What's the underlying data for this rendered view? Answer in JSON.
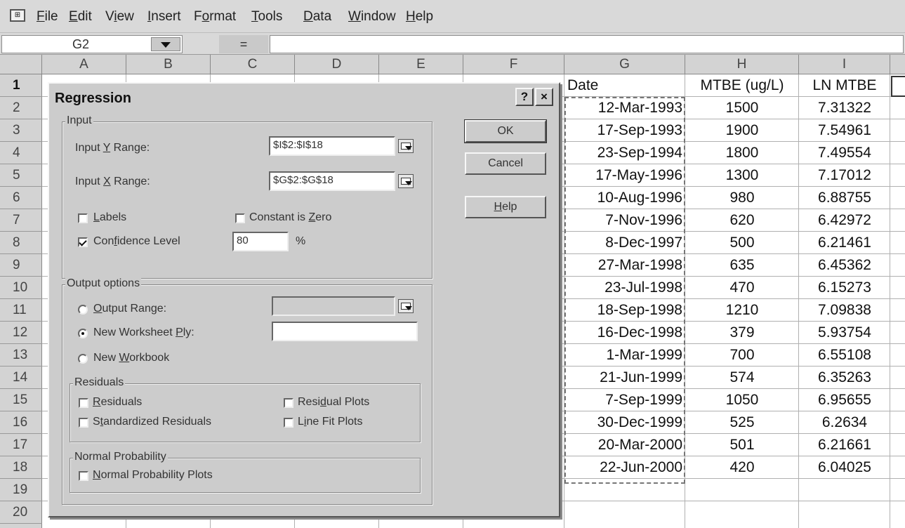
{
  "menu": {
    "icon": "excel-document-icon",
    "items": [
      {
        "accel": "F",
        "rest": "ile"
      },
      {
        "accel": "E",
        "rest": "dit"
      },
      {
        "pre": "V",
        "accel": "i",
        "rest": "ew"
      },
      {
        "accel": "I",
        "rest": "nsert"
      },
      {
        "pre": "F",
        "accel": "o",
        "rest": "rmat"
      },
      {
        "accel": "T",
        "rest": "ools"
      },
      {
        "accel": "D",
        "rest": "ata"
      },
      {
        "accel": "W",
        "rest": "indow"
      },
      {
        "accel": "H",
        "rest": "elp"
      }
    ]
  },
  "formula_bar": {
    "name_box": "G2",
    "equals": "=",
    "content": ""
  },
  "grid": {
    "columns": [
      "A",
      "B",
      "C",
      "D",
      "E",
      "F",
      "G",
      "H",
      "I"
    ],
    "rows": [
      "1",
      "2",
      "3",
      "4",
      "5",
      "6",
      "7",
      "8",
      "9",
      "10",
      "11",
      "12",
      "13",
      "14",
      "15",
      "16",
      "17",
      "18",
      "19",
      "20"
    ],
    "headers": {
      "G": "Date",
      "H": "MTBE (ug/L)",
      "I": "LN MTBE"
    },
    "data": [
      {
        "date": "12-Mar-1993",
        "mtbe": "1500",
        "ln": "7.31322"
      },
      {
        "date": "17-Sep-1993",
        "mtbe": "1900",
        "ln": "7.54961"
      },
      {
        "date": "23-Sep-1994",
        "mtbe": "1800",
        "ln": "7.49554"
      },
      {
        "date": "17-May-1996",
        "mtbe": "1300",
        "ln": "7.17012"
      },
      {
        "date": "10-Aug-1996",
        "mtbe": "980",
        "ln": "6.88755"
      },
      {
        "date": "7-Nov-1996",
        "mtbe": "620",
        "ln": "6.42972"
      },
      {
        "date": "8-Dec-1997",
        "mtbe": "500",
        "ln": "6.21461"
      },
      {
        "date": "27-Mar-1998",
        "mtbe": "635",
        "ln": "6.45362"
      },
      {
        "date": "23-Jul-1998",
        "mtbe": "470",
        "ln": "6.15273"
      },
      {
        "date": "18-Sep-1998",
        "mtbe": "1210",
        "ln": "7.09838"
      },
      {
        "date": "16-Dec-1998",
        "mtbe": "379",
        "ln": "5.93754"
      },
      {
        "date": "1-Mar-1999",
        "mtbe": "700",
        "ln": "6.55108"
      },
      {
        "date": "21-Jun-1999",
        "mtbe": "574",
        "ln": "6.35263"
      },
      {
        "date": "7-Sep-1999",
        "mtbe": "1050",
        "ln": "6.95655"
      },
      {
        "date": "30-Dec-1999",
        "mtbe": "525",
        "ln": "6.2634"
      },
      {
        "date": "20-Mar-2000",
        "mtbe": "501",
        "ln": "6.21661"
      },
      {
        "date": "22-Jun-2000",
        "mtbe": "420",
        "ln": "6.04025"
      }
    ]
  },
  "dialog": {
    "title": "Regression",
    "help_button": "?",
    "close_button": "×",
    "input": {
      "group_label": "Input",
      "y_range_label": {
        "pre": "Input ",
        "accel": "Y",
        "post": " Range:"
      },
      "y_range_value": "$I$2:$I$18",
      "x_range_label": {
        "pre": "Input ",
        "accel": "X",
        "post": " Range:"
      },
      "x_range_value": "$G$2:$G$18",
      "labels": {
        "pre": "",
        "accel": "L",
        "post": "abels",
        "checked": false
      },
      "constant_is_zero": {
        "pre": "Constant is ",
        "accel": "Z",
        "post": "ero",
        "checked": false
      },
      "confidence_level": {
        "pre": "Con",
        "accel": "f",
        "post": "idence Level",
        "checked": true
      },
      "confidence_value": "80",
      "percent": "%"
    },
    "output": {
      "group_label": "Output options",
      "output_range": {
        "pre": "",
        "accel": "O",
        "post": "utput Range:",
        "selected": false
      },
      "new_worksheet_ply": {
        "pre": "New Worksheet ",
        "accel": "P",
        "post": "ly:",
        "selected": true
      },
      "new_workbook": {
        "pre": "New ",
        "accel": "W",
        "post": "orkbook",
        "selected": false
      }
    },
    "residuals": {
      "group_label": "Residuals",
      "residuals": {
        "pre": "",
        "accel": "R",
        "post": "esiduals",
        "checked": false
      },
      "standardized_residuals": {
        "pre": "S",
        "accel": "t",
        "post": "andardized Residuals",
        "checked": false
      },
      "residual_plots": {
        "pre": "Resi",
        "accel": "d",
        "post": "ual Plots",
        "checked": false
      },
      "line_fit_plots": {
        "pre": "L",
        "accel": "i",
        "post": "ne Fit Plots",
        "checked": false
      }
    },
    "normal_probability": {
      "group_label": "Normal Probability",
      "plots": {
        "pre": "",
        "accel": "N",
        "post": "ormal Probability Plots",
        "checked": false
      }
    },
    "buttons": {
      "ok": "OK",
      "cancel": "Cancel",
      "help": {
        "pre": "",
        "accel": "H",
        "post": "elp"
      }
    }
  }
}
